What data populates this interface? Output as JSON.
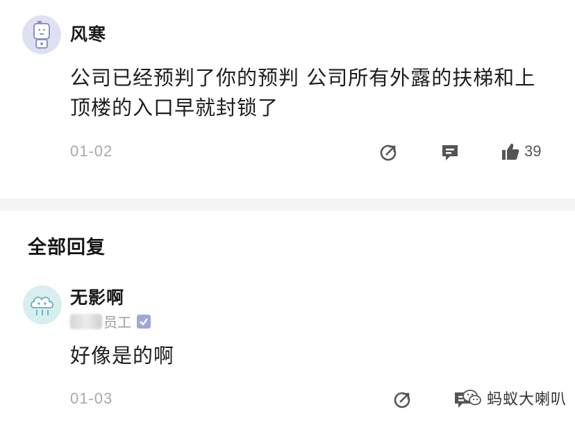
{
  "post": {
    "username": "风寒",
    "content_line1": "公司已经预判了你的预判 公司所有外露的扶梯和上",
    "content_line2": "顶楼的入口早就封锁了",
    "date": "01-02",
    "like_count": "39"
  },
  "replies_section": {
    "title": "全部回复"
  },
  "reply": {
    "username": "无影啊",
    "role_suffix": "员工",
    "content": "好像是的啊",
    "date": "01-03"
  },
  "watermark": {
    "text": "蚂蚁大喇叭"
  },
  "colors": {
    "divider": "#f2f3f5",
    "date_gray": "#a9a9a9",
    "icon_gray": "#555555",
    "verify_badge": "#9ea7d8",
    "avatar1_bg": "#dfe1f3",
    "avatar2_bg": "#d8eef0"
  },
  "icons": {
    "share": "share-icon",
    "comment": "comment-icon",
    "like": "thumbs-up-icon",
    "verify": "verified-check-icon",
    "wechat": "wechat-icon"
  }
}
